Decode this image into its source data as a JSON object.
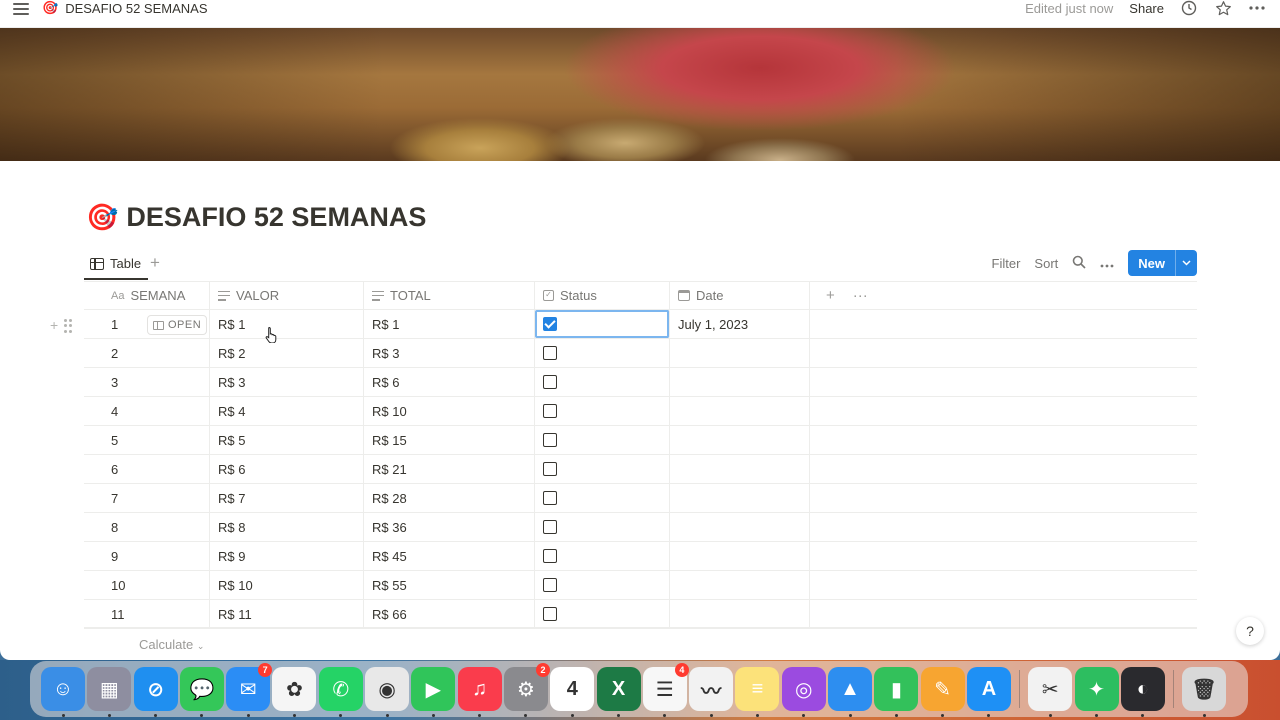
{
  "topbar": {
    "title": "DESAFIO 52 SEMANAS",
    "emoji": "🎯",
    "edited": "Edited just now",
    "share": "Share"
  },
  "page": {
    "emoji": "🎯",
    "title": "DESAFIO 52 SEMANAS"
  },
  "view": {
    "tab_label": "Table",
    "filter": "Filter",
    "sort": "Sort",
    "new_label": "New"
  },
  "table": {
    "columns": {
      "semana": "SEMANA",
      "semana_prefix": "Aa",
      "valor": "VALOR",
      "total": "TOTAL",
      "status": "Status",
      "date": "Date"
    },
    "open_label": "OPEN",
    "rows": [
      {
        "semana": "1",
        "valor": "R$ 1",
        "total": "R$ 1",
        "status": true,
        "date": "July 1, 2023"
      },
      {
        "semana": "2",
        "valor": "R$ 2",
        "total": "R$ 3",
        "status": false,
        "date": ""
      },
      {
        "semana": "3",
        "valor": "R$ 3",
        "total": "R$ 6",
        "status": false,
        "date": ""
      },
      {
        "semana": "4",
        "valor": "R$ 4",
        "total": "R$ 10",
        "status": false,
        "date": ""
      },
      {
        "semana": "5",
        "valor": "R$ 5",
        "total": "R$ 15",
        "status": false,
        "date": ""
      },
      {
        "semana": "6",
        "valor": "R$ 6",
        "total": "R$ 21",
        "status": false,
        "date": ""
      },
      {
        "semana": "7",
        "valor": "R$ 7",
        "total": "R$ 28",
        "status": false,
        "date": ""
      },
      {
        "semana": "8",
        "valor": "R$ 8",
        "total": "R$ 36",
        "status": false,
        "date": ""
      },
      {
        "semana": "9",
        "valor": "R$ 9",
        "total": "R$ 45",
        "status": false,
        "date": ""
      },
      {
        "semana": "10",
        "valor": "R$ 10",
        "total": "R$ 55",
        "status": false,
        "date": ""
      },
      {
        "semana": "11",
        "valor": "R$ 11",
        "total": "R$ 66",
        "status": false,
        "date": ""
      }
    ],
    "calculate": "Calculate"
  },
  "help": "?",
  "dock": {
    "apps": [
      {
        "name": "finder",
        "color": "#3a8ee6",
        "glyph": "☺"
      },
      {
        "name": "launchpad",
        "color": "#8e8ea0",
        "glyph": "▦"
      },
      {
        "name": "safari",
        "color": "#1f8ff0",
        "glyph": "⊘"
      },
      {
        "name": "messages",
        "color": "#34c759",
        "glyph": "💬"
      },
      {
        "name": "mail",
        "color": "#2b8df5",
        "glyph": "✉",
        "badge": "7"
      },
      {
        "name": "photos",
        "color": "#f5f5f5",
        "glyph": "✿"
      },
      {
        "name": "whatsapp",
        "color": "#25d366",
        "glyph": "✆"
      },
      {
        "name": "chrome",
        "color": "#e8e8e8",
        "glyph": "◉"
      },
      {
        "name": "facetime",
        "color": "#30c55a",
        "glyph": "▶"
      },
      {
        "name": "music",
        "color": "#fa3c4c",
        "glyph": "♫"
      },
      {
        "name": "system-settings",
        "color": "#8a8a8e",
        "glyph": "⚙",
        "badge": "2"
      },
      {
        "name": "calendar",
        "color": "#ffffff",
        "glyph": "4"
      },
      {
        "name": "excel",
        "color": "#1d7a45",
        "glyph": "X"
      },
      {
        "name": "reminders",
        "color": "#f7f7f7",
        "glyph": "☰",
        "badge": "4"
      },
      {
        "name": "freeform",
        "color": "#f2f2f2",
        "glyph": "〰"
      },
      {
        "name": "notes",
        "color": "#fce27a",
        "glyph": "≡"
      },
      {
        "name": "podcasts",
        "color": "#9b4be0",
        "glyph": "◎"
      },
      {
        "name": "keynote",
        "color": "#2d8ef0",
        "glyph": "▲"
      },
      {
        "name": "numbers",
        "color": "#33c15b",
        "glyph": "▮"
      },
      {
        "name": "pages",
        "color": "#f7a531",
        "glyph": "✎"
      },
      {
        "name": "app-store",
        "color": "#1e90f5",
        "glyph": "A"
      },
      {
        "name": "capcut",
        "color": "#f2f2f2",
        "glyph": "✂"
      },
      {
        "name": "evernote",
        "color": "#2dbe60",
        "glyph": "✦"
      },
      {
        "name": "obs",
        "color": "#2a2a2e",
        "glyph": "◐"
      },
      {
        "name": "trash",
        "color": "#d8d8d8",
        "glyph": "🗑"
      }
    ]
  }
}
